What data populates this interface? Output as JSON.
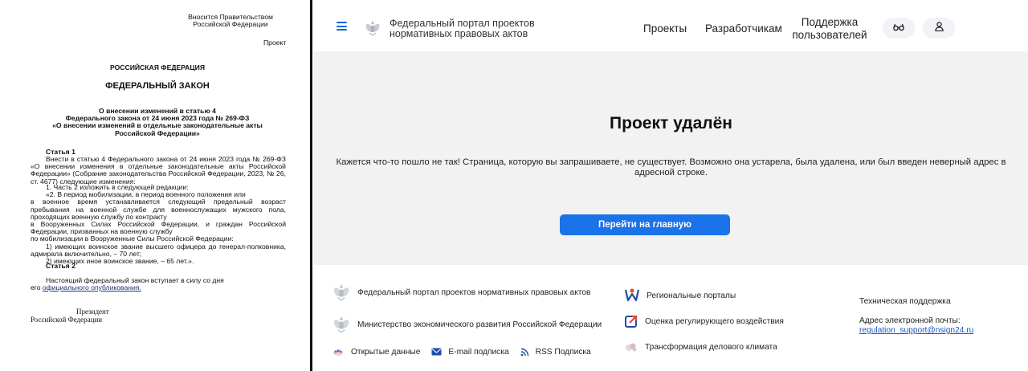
{
  "document": {
    "submitted_line1": "Вносится Правительством",
    "submitted_line2": "Российской Федерации",
    "project_label": "Проект",
    "country": "РОССИЙСКАЯ ФЕДЕРАЦИЯ",
    "law_title": "ФЕДЕРАЛЬНЫЙ ЗАКОН",
    "subject_line1": "О внесении изменений в статью 4",
    "subject_line2": "Федерального закона от 24 июня 2023 года № 269-ФЗ",
    "subject_line3": "«О внесении изменений в отдельные законодательные акты Российской Федерации»",
    "article1_heading": "Статья 1",
    "article1_intro": "Внести в статью 4 Федерального закона от 24 июня 2023 года № 269-ФЗ «О внесении изменения в отдельные законодательные акты Российской Федерации» (Собрание законодательства Российской Федерации, 2023, № 26, ст. 4677) следующие изменения:",
    "item1": "1. Часть 2 изложить в следующей редакции:",
    "quote_line1": "«2. В период мобилизации, в период военного положения или",
    "quote_line2": "в военное время устанавливается следующий предельный возраст пребывания на военной службе для военнослужащих мужского пола, проходящих военную службу по контракту",
    "quote_line3": "в Вооруженных Силах Российской Федерации, и граждан Российской Федерации, призванных на военную службу",
    "quote_line4": "по мобилизации в Вооруженные Силы Российской Федерации:",
    "quote_item1": "1) имеющих воинское звание высшего офицера до генерал-полковника, адмирала включительно, – 70 лет;",
    "quote_item2": "2) имеющих иное воинское звание, – 65 лет.».",
    "article2_heading": "Статья 2",
    "article2_text": "Настоящий федеральный закон вступает в силу со дня",
    "article2_prefix": "его ",
    "article2_link": "официального опубликования.",
    "president": "Президент",
    "federation": "Российской Федерации"
  },
  "header": {
    "portal_title_line1": "Федеральный портал проектов",
    "portal_title_line2": "нормативных правовых актов",
    "nav_projects": "Проекты",
    "nav_developers": "Разработчикам",
    "nav_support_line1": "Поддержка",
    "nav_support_line2": "пользователей",
    "icons": [
      "menu-icon",
      "emblem-icon",
      "glasses-icon",
      "user-icon"
    ]
  },
  "main": {
    "title": "Проект удалён",
    "message": "Кажется что-то пошло не так! Страница, которую вы запрашиваете, не существует. Возможно она устарела, была удалена, или был введен неверный адрес в адресной строке.",
    "home_button": "Перейти на главную"
  },
  "footer": {
    "portal": "Федеральный портал проектов нормативных правовых актов",
    "ministry": "Министерство экономического развития Российской Федерации",
    "open_data": "Открытые данные",
    "email_subscription": "E-mail подписка",
    "rss_subscription": "RSS Подписка",
    "regional_portals": "Региональные порталы",
    "ria": "Оценка регулирующего воздействия",
    "business_climate": "Трансформация делового климата",
    "tech_support": "Техническая поддержка",
    "email_label": "Адрес электронной почты:",
    "email": "regulation_support@nsign24.ru"
  },
  "colors": {
    "accent": "#1a73e8",
    "main_bg": "#f2f2f2",
    "link": "#1a56c4"
  }
}
